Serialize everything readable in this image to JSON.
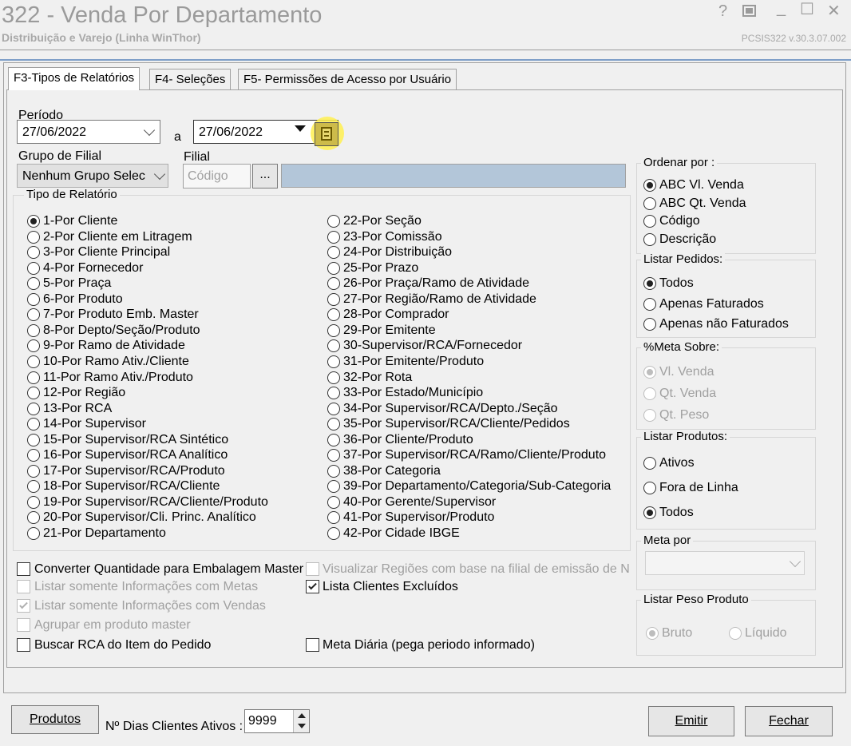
{
  "window": {
    "title": "322 - Venda Por Departamento",
    "subtitle": "Distribuição e Varejo (Linha WinThor)",
    "version": "PCSIS322  v.30.3.07.002",
    "help_glyph": "?",
    "minimize_glyph": "_",
    "maximize_glyph": "☐",
    "close_glyph": "✕"
  },
  "tabs": [
    {
      "label": "F3-Tipos de Relatórios",
      "active": true
    },
    {
      "label": "F4- Seleções",
      "active": false
    },
    {
      "label": "F5- Permissões de Acesso por Usuário",
      "active": false
    }
  ],
  "periodo": {
    "label": "Período",
    "start": "27/06/2022",
    "sep": "a",
    "end": "27/06/2022",
    "calendar_icon": "calendar-icon"
  },
  "grupo_filial": {
    "label": "Grupo de Filial",
    "value": "Nenhum Grupo Selec"
  },
  "filial": {
    "label": "Filial",
    "placeholder": "Código",
    "browse": "...",
    "name": ""
  },
  "tipo_relatorio": {
    "label": "Tipo de Relatório",
    "selected": "1-Por Cliente",
    "col1": [
      "1-Por Cliente",
      "2-Por Cliente em Litragem",
      "3-Por Cliente Principal",
      "4-Por Fornecedor",
      "5-Por Praça",
      "6-Por Produto",
      "7-Por Produto Emb. Master",
      "8-Por Depto/Seção/Produto",
      "9-Por Ramo de Atividade",
      "10-Por Ramo Ativ./Cliente",
      "11-Por Ramo Ativ./Produto",
      "12-Por Região",
      "13-Por RCA",
      "14-Por Supervisor",
      "15-Por Supervisor/RCA Sintético",
      "16-Por Supervisor/RCA Analítico",
      "17-Por Supervisor/RCA/Produto",
      "18-Por Supervisor/RCA/Cliente",
      "19-Por Supervisor/RCA/Cliente/Produto",
      "20-Por Supervisor/Cli. Princ. Analítico",
      "21-Por Departamento"
    ],
    "col2": [
      "22-Por Seção",
      "23-Por Comissão",
      "24-Por Distribuição",
      "25-Por Prazo",
      "26-Por Praça/Ramo de Atividade",
      "27-Por Região/Ramo de Atividade",
      "28-Por Comprador",
      "29-Por Emitente",
      "30-Supervisor/RCA/Fornecedor",
      "31-Por Emitente/Produto",
      "32-Por Rota",
      "33-Por Estado/Município",
      "34-Por Supervisor/RCA/Depto./Seção",
      "35-Por Supervisor/RCA/Cliente/Pedidos",
      "36-Por Cliente/Produto",
      "37-Por Supervisor/RCA/Ramo/Cliente/Produto",
      "38-Por Categoria",
      "39-Por Departamento/Categoria/Sub-Categoria",
      "40-Por Gerente/Supervisor",
      "41-Por Supervisor/Produto",
      "42-Por Cidade IBGE"
    ]
  },
  "options": {
    "converter": "Converter Quantidade para Embalagem Master",
    "visualizar_regioes": "Visualizar Regiões com base na filial de emissão de NF",
    "listar_metas": "Listar somente Informações com Metas",
    "lista_excluidos": "Lista Clientes Excluídos",
    "listar_vendas": "Listar somente Informações com Vendas",
    "agrupar": "Agrupar em produto master",
    "buscar_rca": "Buscar RCA do Item do Pedido",
    "meta_diaria": "Meta Diária (pega periodo informado)"
  },
  "ordenar": {
    "label": "Ordenar por :",
    "options": [
      "ABC Vl. Venda",
      "ABC Qt. Venda",
      "Código",
      "Descrição"
    ],
    "selected": "ABC Vl. Venda"
  },
  "listar_pedidos": {
    "label": "Listar Pedidos:",
    "options": [
      "Todos",
      "Apenas Faturados",
      "Apenas não Faturados"
    ],
    "selected": "Todos"
  },
  "meta_sobre": {
    "label": "%Meta Sobre:",
    "options": [
      "Vl. Venda",
      "Qt. Venda",
      "Qt. Peso"
    ],
    "selected": "Vl. Venda"
  },
  "listar_produtos": {
    "label": "Listar Produtos:",
    "options": [
      "Ativos",
      "Fora de Linha",
      "Todos"
    ],
    "selected": "Todos"
  },
  "meta_por": {
    "label": "Meta por",
    "value": ""
  },
  "listar_peso": {
    "label": "Listar Peso Produto",
    "options": [
      "Bruto",
      "Líquido"
    ],
    "selected": "Bruto"
  },
  "bottom": {
    "produtos": "Produtos",
    "dias_label": "Nº Dias Clientes Ativos :",
    "dias_value": "9999",
    "emitir": "Emitir",
    "fechar": "Fechar"
  }
}
